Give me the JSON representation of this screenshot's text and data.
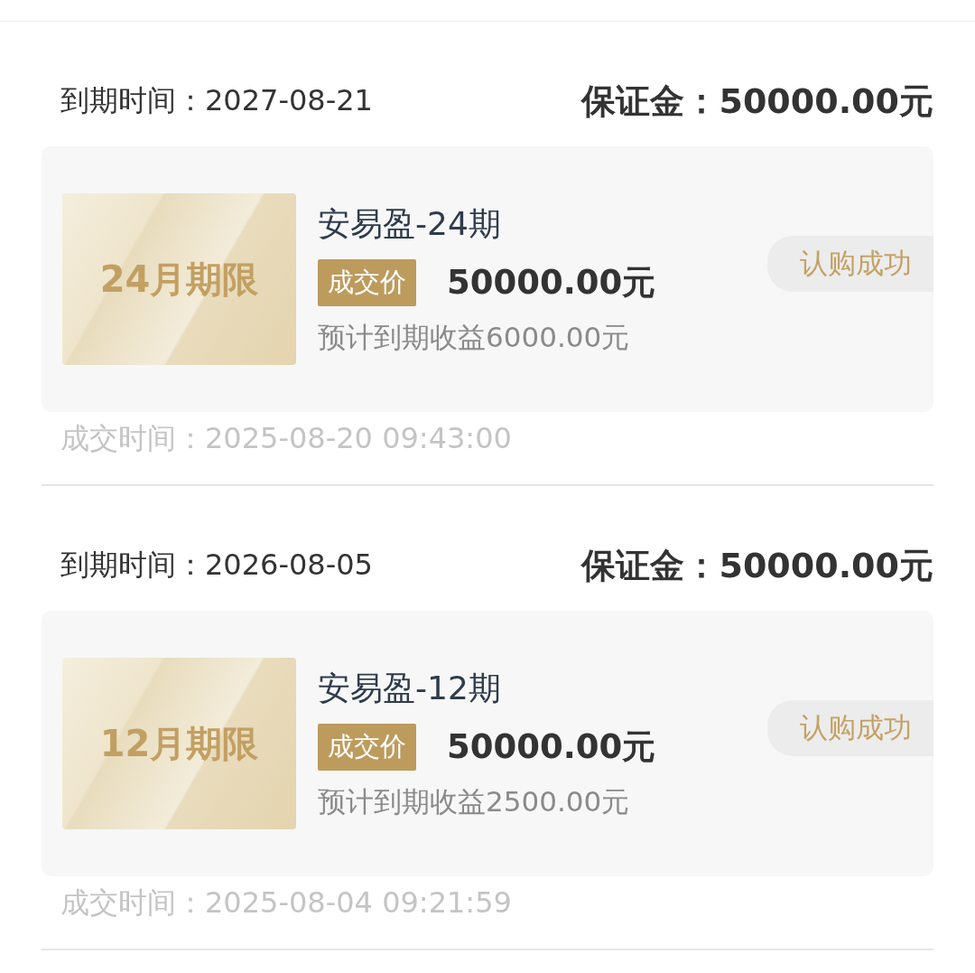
{
  "orders": [
    {
      "expiry_label": "到期时间：",
      "expiry_date": "2027-08-21",
      "deposit_label": "保证金：",
      "deposit_amount": "50000.00元",
      "term_badge": "24月期限",
      "product_name": "安易盈-24期",
      "price_tag": "成交价",
      "price": "50000.00元",
      "expected_income": "预计到期收益6000.00元",
      "status": "认购成功",
      "deal_time_label": "成交时间：",
      "deal_time": "2025-08-20 09:43:00"
    },
    {
      "expiry_label": "到期时间：",
      "expiry_date": "2026-08-05",
      "deposit_label": "保证金：",
      "deposit_amount": "50000.00元",
      "term_badge": "12月期限",
      "product_name": "安易盈-12期",
      "price_tag": "成交价",
      "price": "50000.00元",
      "expected_income": "预计到期收益2500.00元",
      "status": "认购成功",
      "deal_time_label": "成交时间：",
      "deal_time": "2025-08-04 09:21:59"
    }
  ]
}
